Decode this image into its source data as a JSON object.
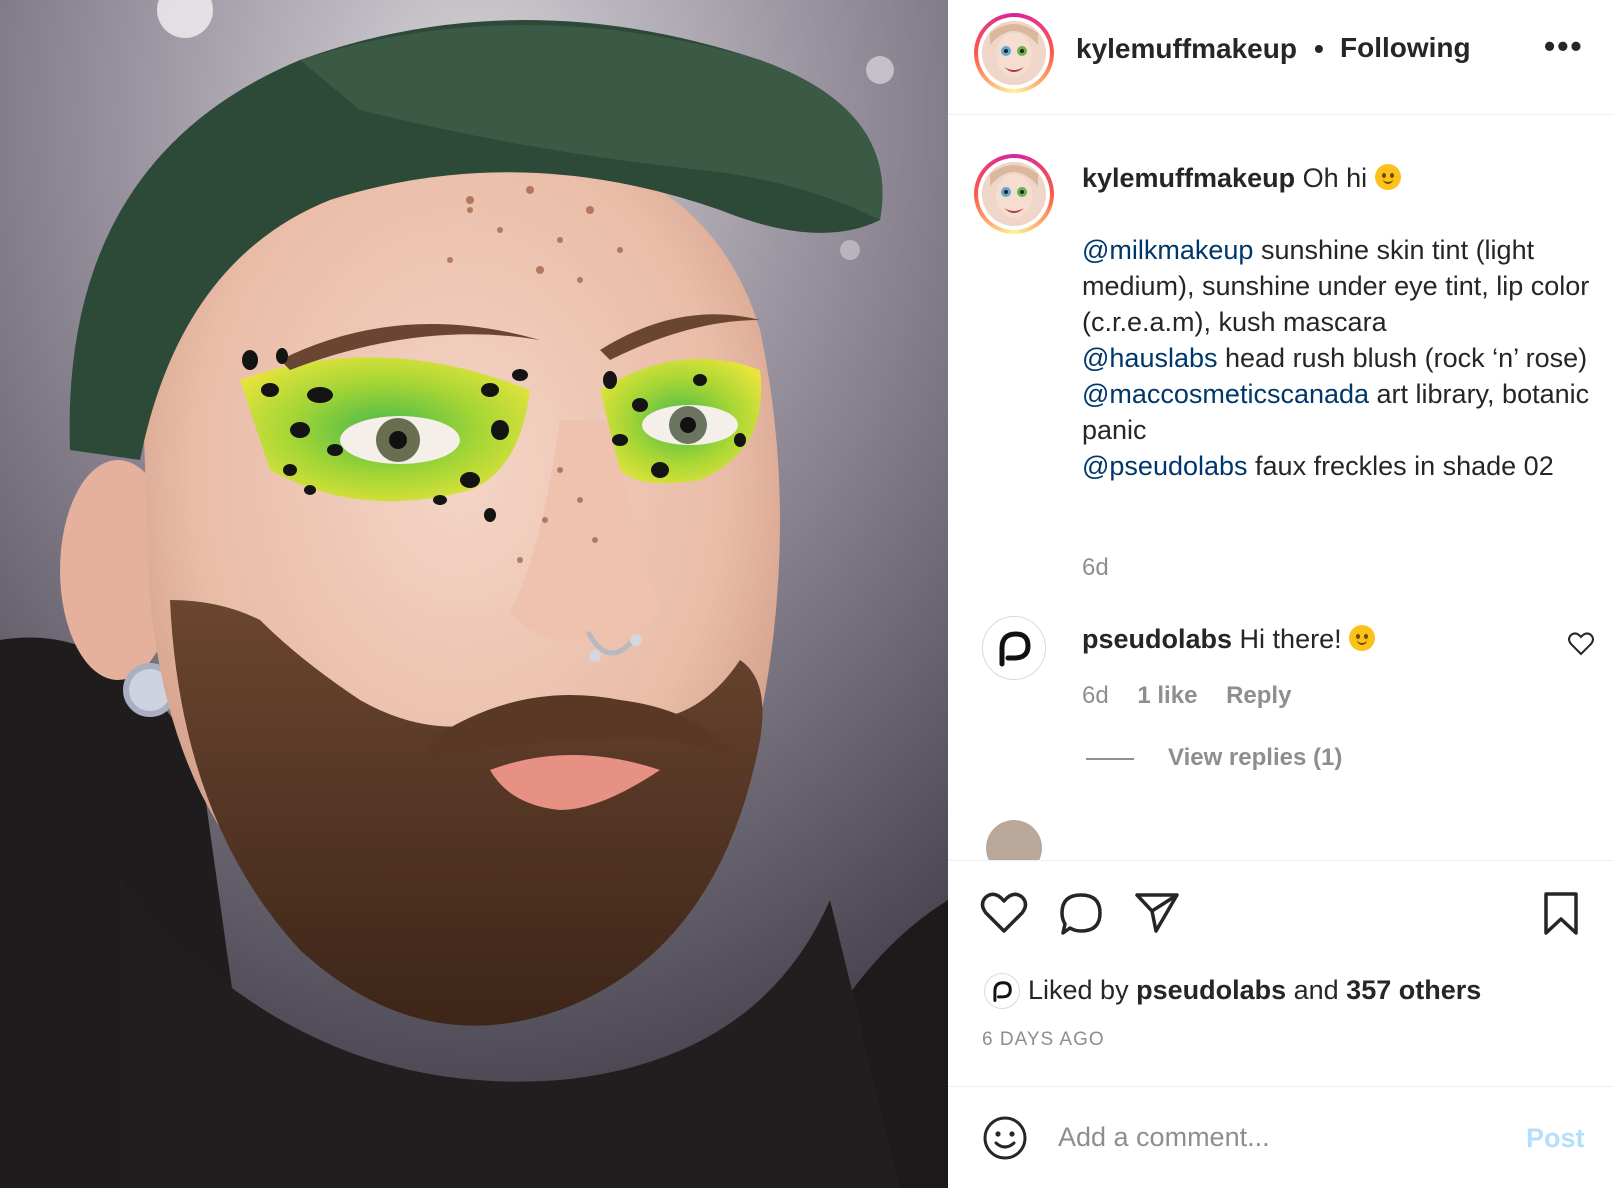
{
  "post": {
    "username": "kylemuffmakeup",
    "follow_label": "Following",
    "separator": "•",
    "more_label": "•••"
  },
  "caption": {
    "username": "kylemuffmakeup",
    "intro": "Oh hi",
    "mention1": "@milkmakeup",
    "text1": " sunshine skin tint (light medium), sunshine under eye tint, lip color (c.r.e.a.m), kush mascara",
    "mention2": "@hauslabs",
    "text2": " head rush blush (rock ‘n’ rose)",
    "mention3": "@maccosmeticscanada",
    "text3": " art library, botanic panic",
    "mention4": "@pseudolabs",
    "text4": " faux freckles in shade 02",
    "time": "6d"
  },
  "comment1": {
    "username": "pseudolabs",
    "text": "Hi there!",
    "time": "6d",
    "likes": "1 like",
    "reply_label": "Reply",
    "view_replies": "View replies (1)"
  },
  "likes": {
    "prefix": "Liked by ",
    "user": "pseudolabs",
    "middle": " and ",
    "others": "357 others"
  },
  "timestamp": "6 DAYS AGO",
  "add_comment": {
    "placeholder": "Add a comment...",
    "post_label": "Post"
  },
  "icons": {
    "like": "heart-icon",
    "comment": "comment-icon",
    "share": "paper-plane-icon",
    "save": "bookmark-icon",
    "emoji": "smiley-icon"
  },
  "colors": {
    "mention": "#00376b",
    "muted": "#8e8e8e",
    "post_disabled": "#b2dffc"
  }
}
